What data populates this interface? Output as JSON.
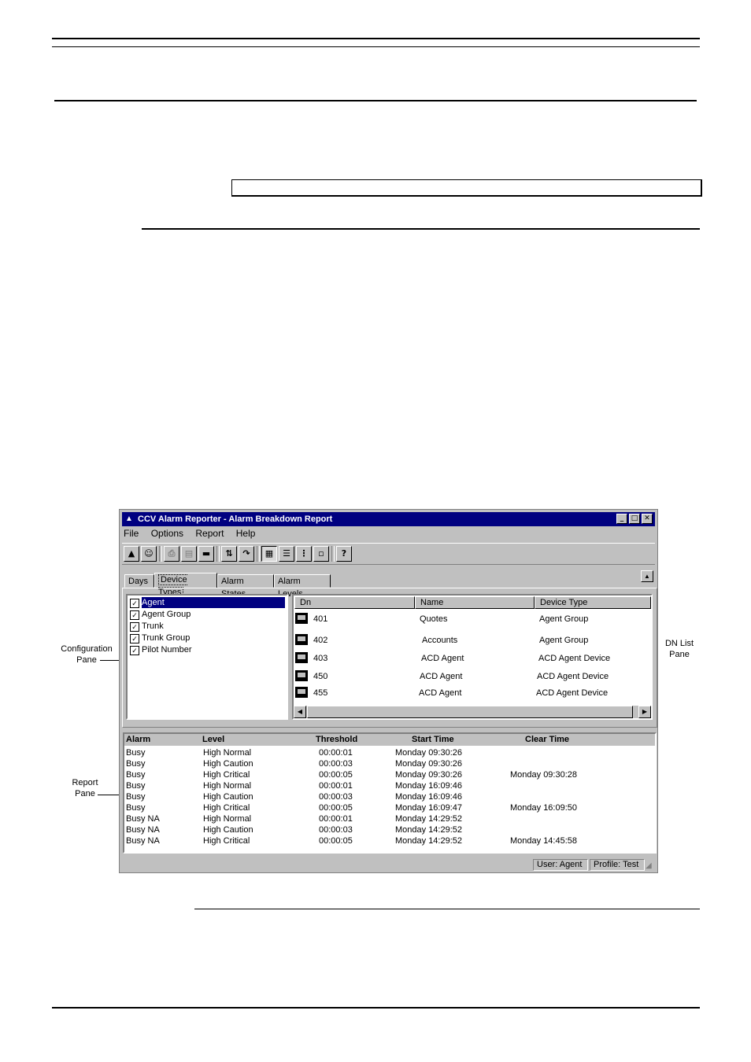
{
  "window": {
    "title": "CCV Alarm Reporter - Alarm Breakdown Report",
    "menu": [
      "File",
      "Options",
      "Report",
      "Help"
    ],
    "caption_buttons": {
      "minimize": "_",
      "maximize": "□",
      "close": "✕"
    }
  },
  "tabs": [
    "Days",
    "Device Types",
    "Alarm States",
    "Alarm Levels"
  ],
  "active_tab": "Device Types",
  "config_pane": {
    "items": [
      {
        "label": "Agent",
        "checked": true,
        "selected": true
      },
      {
        "label": "Agent Group",
        "checked": true
      },
      {
        "label": "Trunk",
        "checked": true
      },
      {
        "label": "Trunk Group",
        "checked": true
      },
      {
        "label": "Pilot Number",
        "checked": true
      }
    ]
  },
  "dn_list": {
    "columns": [
      "Dn",
      "Name",
      "Device Type"
    ],
    "rows": [
      {
        "dn": "401",
        "name": "Quotes",
        "type": "Agent Group"
      },
      {
        "dn": "402",
        "name": "Accounts",
        "type": "Agent Group"
      },
      {
        "dn": "403",
        "name": "ACD Agent",
        "type": "ACD Agent Device"
      },
      {
        "dn": "450",
        "name": "ACD Agent",
        "type": "ACD Agent Device"
      },
      {
        "dn": "455",
        "name": "ACD Agent",
        "type": "ACD Agent Device"
      }
    ]
  },
  "report": {
    "columns": [
      "Alarm",
      "Level",
      "Threshold",
      "Start Time",
      "Clear Time"
    ],
    "rows": [
      [
        "Busy",
        "High Normal",
        "00:00:01",
        "Monday 09:30:26",
        ""
      ],
      [
        "Busy",
        "High Caution",
        "00:00:03",
        "Monday 09:30:26",
        ""
      ],
      [
        "Busy",
        "High Critical",
        "00:00:05",
        "Monday 09:30:26",
        "Monday 09:30:28"
      ],
      [
        "Busy",
        "High Normal",
        "00:00:01",
        "Monday 16:09:46",
        ""
      ],
      [
        "Busy",
        "High Caution",
        "00:00:03",
        "Monday 16:09:46",
        ""
      ],
      [
        "Busy",
        "High Critical",
        "00:00:05",
        "Monday 16:09:47",
        "Monday 16:09:50"
      ],
      [
        "Busy NA",
        "High Normal",
        "00:00:01",
        "Monday 14:29:52",
        ""
      ],
      [
        "Busy NA",
        "High Caution",
        "00:00:03",
        "Monday 14:29:52",
        ""
      ],
      [
        "Busy NA",
        "High Critical",
        "00:00:05",
        "Monday 14:29:52",
        "Monday 14:45:58"
      ]
    ]
  },
  "status": {
    "user": "User: Agent",
    "profile": "Profile: Test"
  },
  "callouts": {
    "config": [
      "Configuration",
      "Pane"
    ],
    "dnlist": [
      "DN List",
      "Pane"
    ],
    "report": [
      "Report",
      "Pane"
    ]
  }
}
